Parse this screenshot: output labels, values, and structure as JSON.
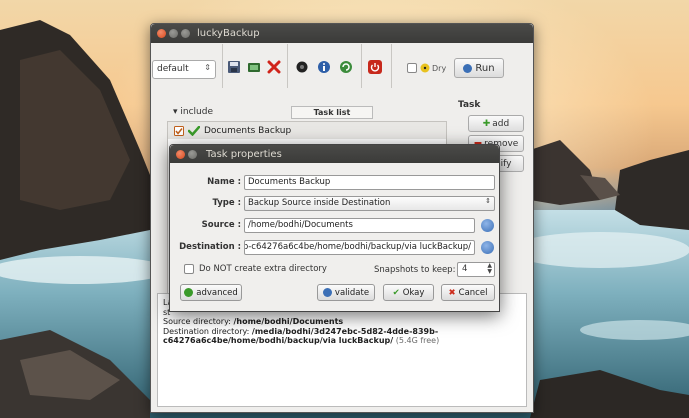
{
  "main_window": {
    "title": "luckyBackup",
    "profile": "default",
    "dry_label": "Dry",
    "run_label": "Run",
    "include_label": "include",
    "task_list_header": "Task list",
    "task_header": "Task",
    "tasks": [
      {
        "name": "Documents Backup",
        "checked": true
      }
    ],
    "buttons": {
      "add": "add",
      "remove": "remove",
      "modify": "modify"
    },
    "info": {
      "line1": "La",
      "line2": "st",
      "source_label": "Source directory:",
      "source_value": "/home/bodhi/Documents",
      "dest_label": "Destination directory:",
      "dest_value": "/media/bodhi/3d247ebc-5d82-4dde-839b-",
      "dest_value2": "c64276a6c4be/home/bodhi/backup/via luckBackup/",
      "free": "(5.4G free)"
    }
  },
  "dialog": {
    "title": "Task properties",
    "name_label": "Name :",
    "name_value": "Documents Backup",
    "type_label": "Type :",
    "type_value": "Backup Source inside Destination",
    "source_label": "Source :",
    "source_value": "/home/bodhi/Documents",
    "destination_label": "Destination :",
    "destination_value": "lb-c64276a6c4be/home/bodhi/backup/via luckBackup/",
    "no_extra_dir_label": "Do NOT create extra directory",
    "snapshots_label": "Snapshots to keep:",
    "snapshots_value": "4",
    "advanced_label": "advanced",
    "validate_label": "validate",
    "okay_label": "Okay",
    "cancel_label": "Cancel"
  },
  "colors": {
    "title_bar": "#3b3b39",
    "close_button": "#d9481c",
    "ok_green": "#3a9a2a",
    "cancel_red": "#cc2a1a",
    "info_blue": "#3b6fb6"
  }
}
